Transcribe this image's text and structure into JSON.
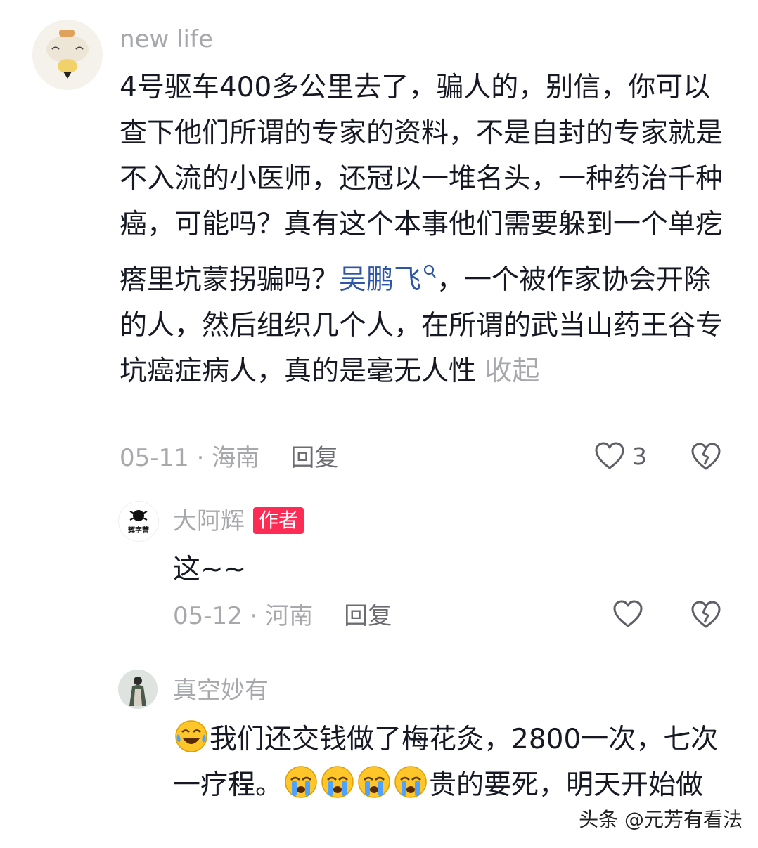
{
  "comment1": {
    "username": "new life",
    "text_before_mention": "4号驱车400多公里去了，骗人的，别信，你可以查下他们所谓的专家的资料，不是自封的专家就是不入流的小医师，还冠以一堆名头，一种药治千种癌，可能吗？真有这个本事他们需要躲到一个单疙瘩里坑蒙拐骗吗？",
    "mention": "吴鹏飞",
    "text_after_mention": "，一个被作家协会开除的人，然后组织几个人，在所谓的武当山药王谷专坑癌症病人，真的是毫无人性",
    "collapse_label": "收起",
    "date": "05-11",
    "location": "海南",
    "reply_label": "回复",
    "like_count": "3"
  },
  "reply1": {
    "username": "大阿辉",
    "author_badge": "作者",
    "avatar_text": "辉字营",
    "text": "这~~",
    "date": "05-12",
    "location": "河南",
    "reply_label": "回复"
  },
  "comment2": {
    "username": "真空妙有",
    "text_part1": "我们还交钱做了梅花灸，2800一次，七次一疗程。",
    "text_part2": "贵的要死，明天开始做"
  },
  "watermark": "头条 @元芳有看法",
  "icons": {
    "like": "heart-outline-icon",
    "dislike": "broken-heart-icon",
    "search": "search-icon",
    "laugh_cry": "laugh-cry-emoji",
    "crying": "crying-emoji"
  }
}
